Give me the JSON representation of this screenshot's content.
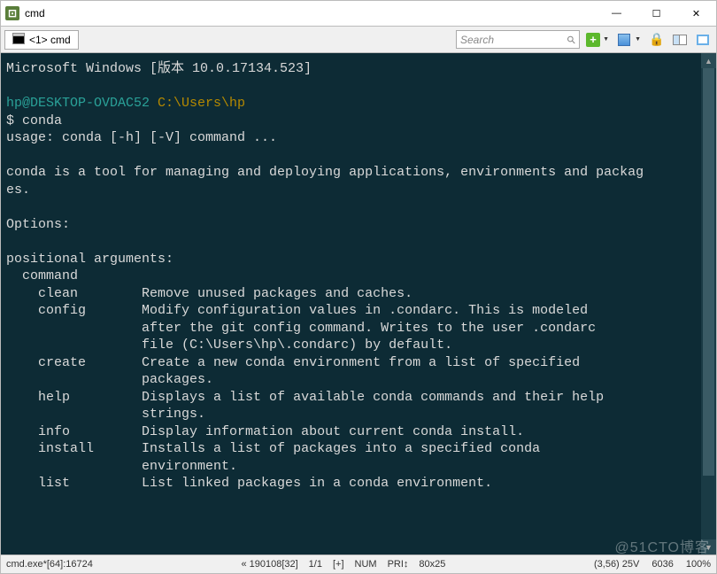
{
  "window": {
    "title": "cmd",
    "minimize": "—",
    "maximize": "☐",
    "close": "✕"
  },
  "tab": {
    "label": "<1> cmd"
  },
  "toolbar": {
    "search_placeholder": "Search",
    "plus_label": "+"
  },
  "terminal": {
    "line1": "Microsoft Windows [版本 10.0.17134.523]",
    "blank": "",
    "user": "hp@DESKTOP-OVDAC52",
    "path": " C:\\Users\\hp",
    "prompt": "$ conda",
    "usage": "usage: conda [-h] [-V] command ...",
    "desc1": "conda is a tool for managing and deploying applications, environments and packag",
    "desc2": "es.",
    "options": "Options:",
    "posargs": "positional arguments:",
    "command": "  command",
    "cmd_clean": "    clean        Remove unused packages and caches.",
    "cmd_config1": "    config       Modify configuration values in .condarc. This is modeled",
    "cmd_config2": "                 after the git config command. Writes to the user .condarc",
    "cmd_config3": "                 file (C:\\Users\\hp\\.condarc) by default.",
    "cmd_create1": "    create       Create a new conda environment from a list of specified",
    "cmd_create2": "                 packages.",
    "cmd_help1": "    help         Displays a list of available conda commands and their help",
    "cmd_help2": "                 strings.",
    "cmd_info": "    info         Display information about current conda install.",
    "cmd_install1": "    install      Installs a list of packages into a specified conda",
    "cmd_install2": "                 environment.",
    "cmd_list": "    list         List linked packages in a conda environment."
  },
  "status": {
    "left": "cmd.exe*[64]:16724",
    "c1": "« 190108[32]",
    "c2": "1/1",
    "c3": "[+]",
    "c4": "NUM",
    "c5": "PRI↕",
    "c6": "80x25",
    "r1": "(3,56) 25V",
    "r2": "6036",
    "r3": "100%"
  },
  "watermark": "@51CTO博客"
}
